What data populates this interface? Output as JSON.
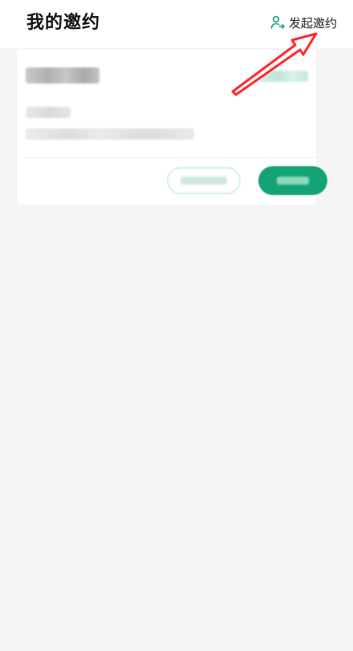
{
  "header": {
    "title": "我的邀约",
    "action_label": "发起邀约",
    "action_icon": "user-add-icon"
  },
  "colors": {
    "accent": "#14a376",
    "annotation": "#ff2a2a",
    "background": "#f5f5f5"
  },
  "card": {
    "title": "",
    "status": "",
    "line1": "",
    "line2": "",
    "secondary_button": "",
    "primary_button": ""
  }
}
